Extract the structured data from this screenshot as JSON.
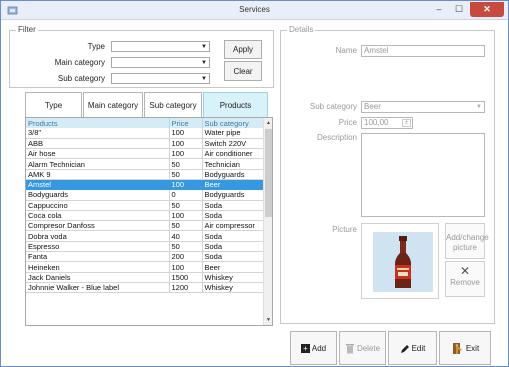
{
  "window": {
    "title": "Services",
    "minimize": "–",
    "maximize": "☐",
    "close": "✕"
  },
  "filter": {
    "legend": "Filter",
    "type_label": "Type",
    "main_category_label": "Main category",
    "sub_category_label": "Sub category",
    "type_value": "",
    "main_category_value": "",
    "sub_category_value": "",
    "apply": "Apply",
    "clear": "Clear"
  },
  "tabs": [
    {
      "label": "Type"
    },
    {
      "label": "Main category"
    },
    {
      "label": "Sub category"
    },
    {
      "label": "Products",
      "active": true
    }
  ],
  "grid": {
    "columns": [
      "Products",
      "Price",
      "Sub category"
    ],
    "rows": [
      [
        "3/8\"",
        "100",
        "Water pipe"
      ],
      [
        "ABB",
        "100",
        "Switch 220V"
      ],
      [
        "Air hose",
        "100",
        "Air conditioner"
      ],
      [
        "Alarm Technician",
        "50",
        "Technician"
      ],
      [
        "AMK 9",
        "50",
        "Bodyguards"
      ],
      [
        "Amstel",
        "100",
        "Beer"
      ],
      [
        "Bodyguards",
        "0",
        "Bodyguards"
      ],
      [
        "Cappuccino",
        "50",
        "Soda"
      ],
      [
        "Coca cola",
        "100",
        "Soda"
      ],
      [
        "Compresor Danfoss",
        "50",
        "Air compressor"
      ],
      [
        "Dobra voda",
        "40",
        "Soda"
      ],
      [
        "Espresso",
        "50",
        "Soda"
      ],
      [
        "Fanta",
        "200",
        "Soda"
      ],
      [
        "Heineken",
        "100",
        "Beer"
      ],
      [
        "Jack Daniels",
        "1500",
        "Whiskey"
      ],
      [
        "Johnnie Walker - Blue label",
        "1200",
        "Whiskey"
      ]
    ],
    "selected_index": 5
  },
  "details": {
    "legend": "Details",
    "name_label": "Name",
    "name_value": "Amstel",
    "sub_category_label": "Sub category",
    "sub_category_value": "Beer",
    "price_label": "Price",
    "price_value": "100,00",
    "description_label": "Description",
    "description_value": "",
    "picture_label": "Picture",
    "add_change_picture": "Add/change picture",
    "remove": "Remove"
  },
  "actions": {
    "add": "Add",
    "delete": "Delete",
    "edit": "Edit",
    "exit": "Exit"
  },
  "colors": {
    "accent_tab": "#d7f2f8",
    "selected_row": "#3598e0",
    "close_button": "#c74a3f",
    "header_text": "#3a7ba0"
  }
}
